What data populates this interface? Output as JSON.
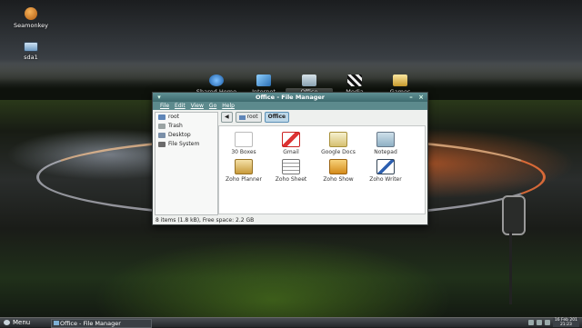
{
  "desktop_icons": [
    {
      "label": "Seamonkey",
      "icon": "seamonkey-icon"
    },
    {
      "label": "sda1",
      "icon": "drive-icon"
    }
  ],
  "dock": [
    {
      "label": "Shared Home",
      "icon": "network-globe-icon"
    },
    {
      "label": "Internet",
      "icon": "internet-icon"
    },
    {
      "label": "Office",
      "icon": "office-folder-icon",
      "active": true
    },
    {
      "label": "Media",
      "icon": "clapperboard-icon"
    },
    {
      "label": "Games",
      "icon": "games-icon"
    }
  ],
  "window": {
    "title": "Office - File Manager",
    "menu": [
      "File",
      "Edit",
      "View",
      "Go",
      "Help"
    ],
    "sidebar": [
      {
        "label": "root",
        "icon": "home-icon"
      },
      {
        "label": "Trash",
        "icon": "trash-icon"
      },
      {
        "label": "Desktop",
        "icon": "desktop-icon"
      },
      {
        "label": "File System",
        "icon": "harddisk-icon"
      }
    ],
    "path": [
      "root",
      "Office"
    ],
    "files": [
      {
        "label": "30 Boxes",
        "icon": "document-icon"
      },
      {
        "label": "Gmail",
        "icon": "gmail-icon"
      },
      {
        "label": "Google Docs",
        "icon": "google-docs-icon"
      },
      {
        "label": "Notepad",
        "icon": "notepad-icon"
      },
      {
        "label": "Zoho Planner",
        "icon": "planner-icon"
      },
      {
        "label": "Zoho Sheet",
        "icon": "spreadsheet-icon"
      },
      {
        "label": "Zoho Show",
        "icon": "presentation-icon"
      },
      {
        "label": "Zoho Writer",
        "icon": "writer-icon"
      }
    ],
    "status": "8 items (1.8 kB), Free space: 2.2 GB"
  },
  "taskbar": {
    "menu_label": "Menu",
    "task_label": "Office - File Manager",
    "clock_date": "16 Feb 201",
    "clock_time": "21:23"
  }
}
